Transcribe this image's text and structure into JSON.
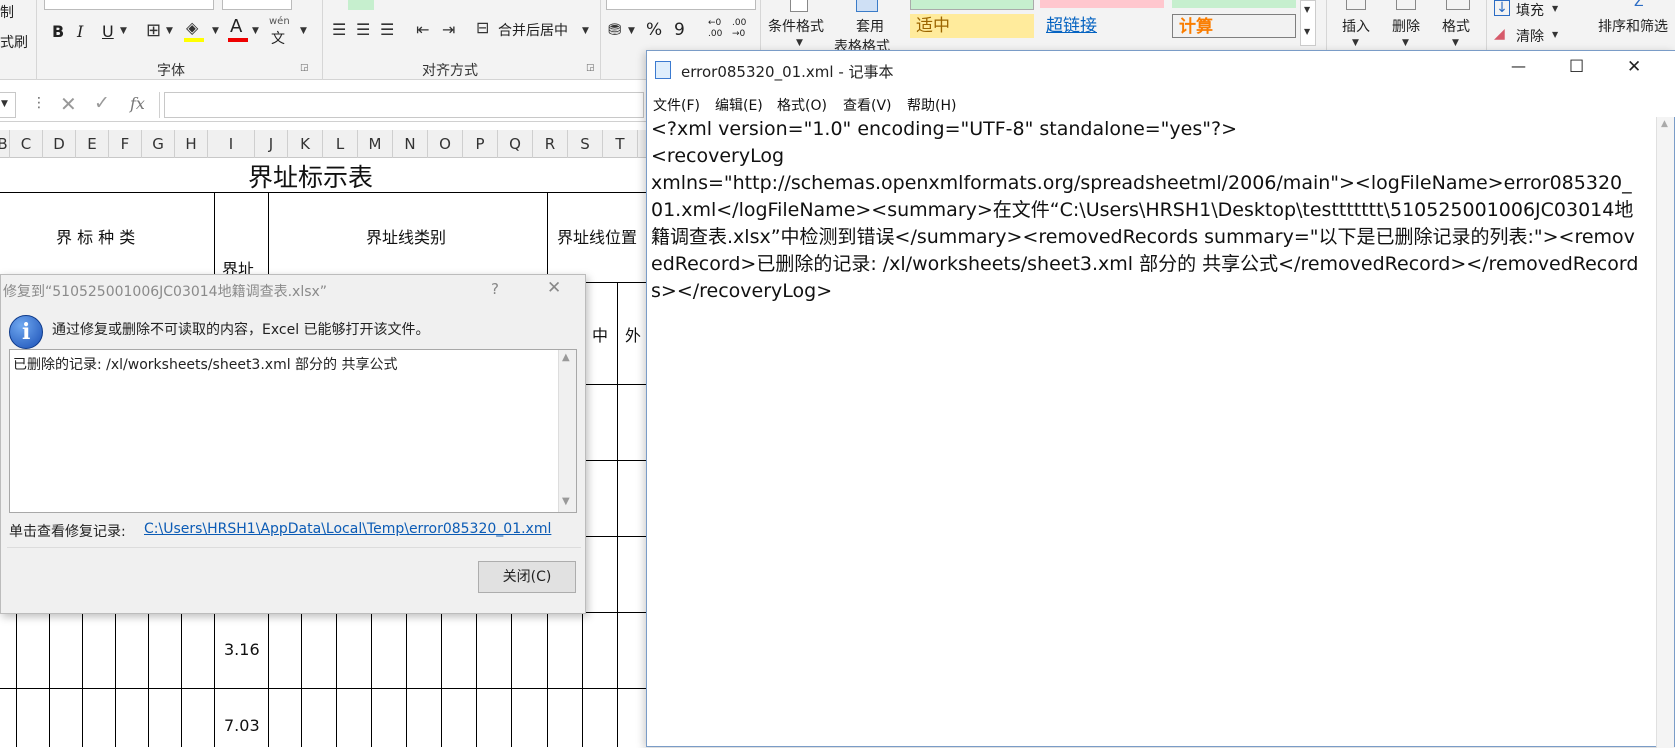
{
  "excel": {
    "ribbon": {
      "left_cut_1": "制",
      "left_cut_2": "式刷",
      "bold": "B",
      "italic": "I",
      "underline": "U",
      "font_color_glyph": "A",
      "wen": "wén",
      "wen2": "文",
      "font_group": "字体",
      "merge_center": "合并后居中",
      "align_group": "对齐方式",
      "percent": "%",
      "comma": "9",
      "dec_inc": "←0 .00",
      "dec_dec": ".00 →0",
      "cond_format": "条件格式",
      "table_format_1": "套用",
      "table_format_2": "表格格式",
      "style_neutral": "适中",
      "style_hyperlink": "超链接",
      "style_calc": "计算",
      "insert": "插入",
      "delete": "删除",
      "format": "格式",
      "fill": "填充",
      "clear": "清除",
      "sort_filter": "排序和筛选",
      "accent_green": "#217346"
    },
    "formula_bar": {
      "fx": "fx",
      "value": ""
    },
    "columns": [
      "B",
      "C",
      "D",
      "E",
      "F",
      "G",
      "H",
      "I",
      "J",
      "K",
      "L",
      "M",
      "N",
      "O",
      "P",
      "Q",
      "R",
      "S",
      "T"
    ],
    "sheet": {
      "title": "界址标示表",
      "header_marker_type": "界 标 种 类",
      "header_boundary_label_1": "界址",
      "header_line_type": "界址线类别",
      "header_line_position": "界址线位置",
      "pos_middle": "中",
      "pos_outer": "外",
      "distance_1": "3.16",
      "distance_2": "7.03"
    }
  },
  "repair_dialog": {
    "title": "修复到“510525001006JC03014地籍调查表.xlsx”",
    "help": "?",
    "close_x": "✕",
    "message": "通过修复或删除不可读取的内容，Excel 已能够打开该文件。",
    "details": "已删除的记录: /xl/worksheets/sheet3.xml 部分的 共享公式",
    "log_label": "单击查看修复记录:",
    "log_link": "C:\\Users\\HRSH1\\AppData\\Local\\Temp\\error085320_01.xml",
    "close_button": "关闭(C)",
    "link_color": "#0b5bb5"
  },
  "notepad": {
    "title": "error085320_01.xml - 记事本",
    "min": "—",
    "max": "☐",
    "close": "✕",
    "menu": [
      "文件(F)",
      "编辑(E)",
      "格式(O)",
      "查看(V)",
      "帮助(H)"
    ],
    "content": "<?xml version=\"1.0\" encoding=\"UTF-8\" standalone=\"yes\"?>\n<recoveryLog\nxmlns=\"http://schemas.openxmlformats.org/spreadsheetml/2006/main\"><logFileName>error085320_01.xml</logFileName><summary>在文件“C:\\Users\\HRSH1\\Desktop\\testtttttt\\510525001006JC03014地籍调查表.xlsx”中检测到错误</summary><removedRecords summary=\"以下是已删除记录的列表:\"><removedRecord>已删除的记录: /xl/worksheets/sheet3.xml 部分的 共享公式</removedRecord></removedRecords></recoveryLog>"
  }
}
